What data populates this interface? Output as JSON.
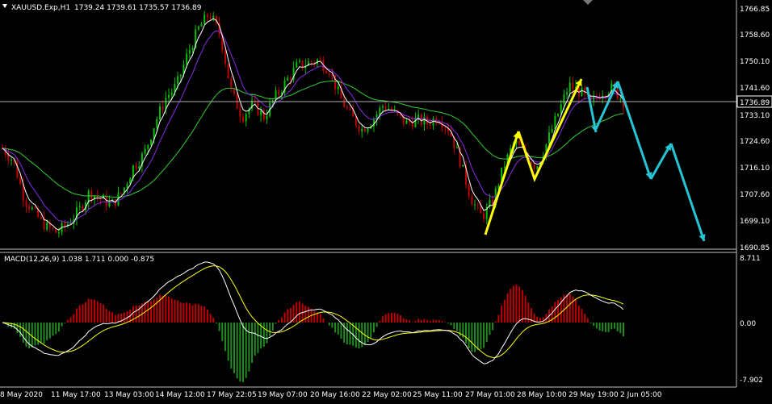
{
  "header": {
    "symbol": "XAUUSD.Exp,H1",
    "ohlc": "1739.24 1739.61 1735.57 1736.89"
  },
  "macd": {
    "label": "MACD(12,26,9) 1.038 1.711 0.000 -0.875",
    "levels": [
      "8.711",
      "0.00",
      "-7.902"
    ]
  },
  "price_axis": {
    "labels": [
      "1766.85",
      "1758.60",
      "1750.10",
      "1741.60",
      "1733.10",
      "1724.60",
      "1716.10",
      "1707.60",
      "1699.10",
      "1690.85"
    ],
    "current_price": "1736.89"
  },
  "time_axis": {
    "labels": [
      "8 May 2020",
      "11 May 17:00",
      "13 May 03:00",
      "14 May 12:00",
      "17 May 22:05",
      "19 May 07:00",
      "20 May 16:00",
      "22 May 02:00",
      "25 May 11:00",
      "27 May 01:00",
      "28 May 10:00",
      "29 May 19:00",
      "2 Jun 05:00"
    ]
  },
  "colors": {
    "background": "#000000",
    "bull_candle": "#00c000",
    "bear_candle": "#c00000",
    "ma_fast": "#ffffff",
    "ma_mid": "#8a2be2",
    "ma_slow": "#32cd32",
    "macd_line": "#ffffff",
    "signal_line": "#ffff00",
    "hist_positive": "#c00000",
    "hist_negative": "#228b22",
    "arrow_yellow": "#ffff00",
    "arrow_cyan": "#25c5d5",
    "axis_text": "#ffffff"
  },
  "chart_data": {
    "type": "line",
    "series": [
      {
        "name": "XAUUSD.Exp,H1",
        "values": [
          1722,
          1718,
          1706,
          1701,
          1697,
          1695,
          1698,
          1702,
          1708,
          1706,
          1704,
          1708,
          1716,
          1720,
          1730,
          1738,
          1742,
          1752,
          1760,
          1765,
          1758,
          1740,
          1732,
          1736,
          1732,
          1738,
          1743,
          1748,
          1749,
          1750,
          1747,
          1738,
          1732,
          1728,
          1731,
          1736,
          1733,
          1730,
          1731,
          1730,
          1732,
          1728,
          1718,
          1706,
          1700,
          1705,
          1716,
          1724,
          1720,
          1716,
          1724,
          1733,
          1742,
          1740,
          1736,
          1740,
          1741,
          1737
        ]
      }
    ]
  }
}
